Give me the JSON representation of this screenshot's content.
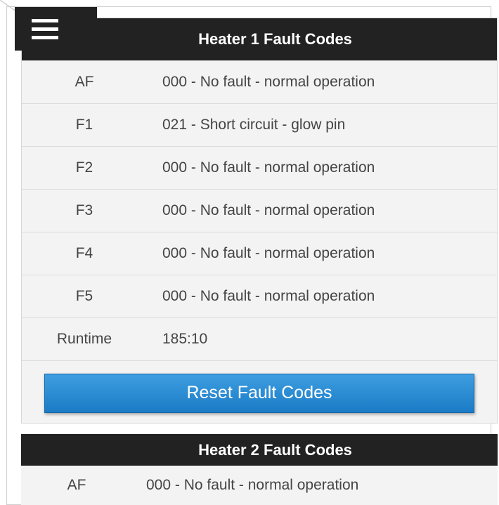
{
  "heater1": {
    "title": "Heater 1 Fault Codes",
    "rows": [
      {
        "code": "AF",
        "desc": "000 - No fault - normal operation"
      },
      {
        "code": "F1",
        "desc": "021 - Short circuit - glow pin"
      },
      {
        "code": "F2",
        "desc": "000 - No fault - normal operation"
      },
      {
        "code": "F3",
        "desc": "000 - No fault - normal operation"
      },
      {
        "code": "F4",
        "desc": "000 - No fault - normal operation"
      },
      {
        "code": "F5",
        "desc": "000 - No fault - normal operation"
      },
      {
        "code": "Runtime",
        "desc": "185:10"
      }
    ],
    "reset_label": "Reset Fault Codes"
  },
  "heater2": {
    "title": "Heater 2 Fault Codes",
    "rows": [
      {
        "code": "AF",
        "desc": "000 - No fault - normal operation"
      }
    ]
  },
  "icons": {
    "menu": "hamburger-menu-icon"
  },
  "colors": {
    "header_bg": "#222222",
    "button": "#2a8ad4",
    "row_bg": "#f3f3f3"
  }
}
